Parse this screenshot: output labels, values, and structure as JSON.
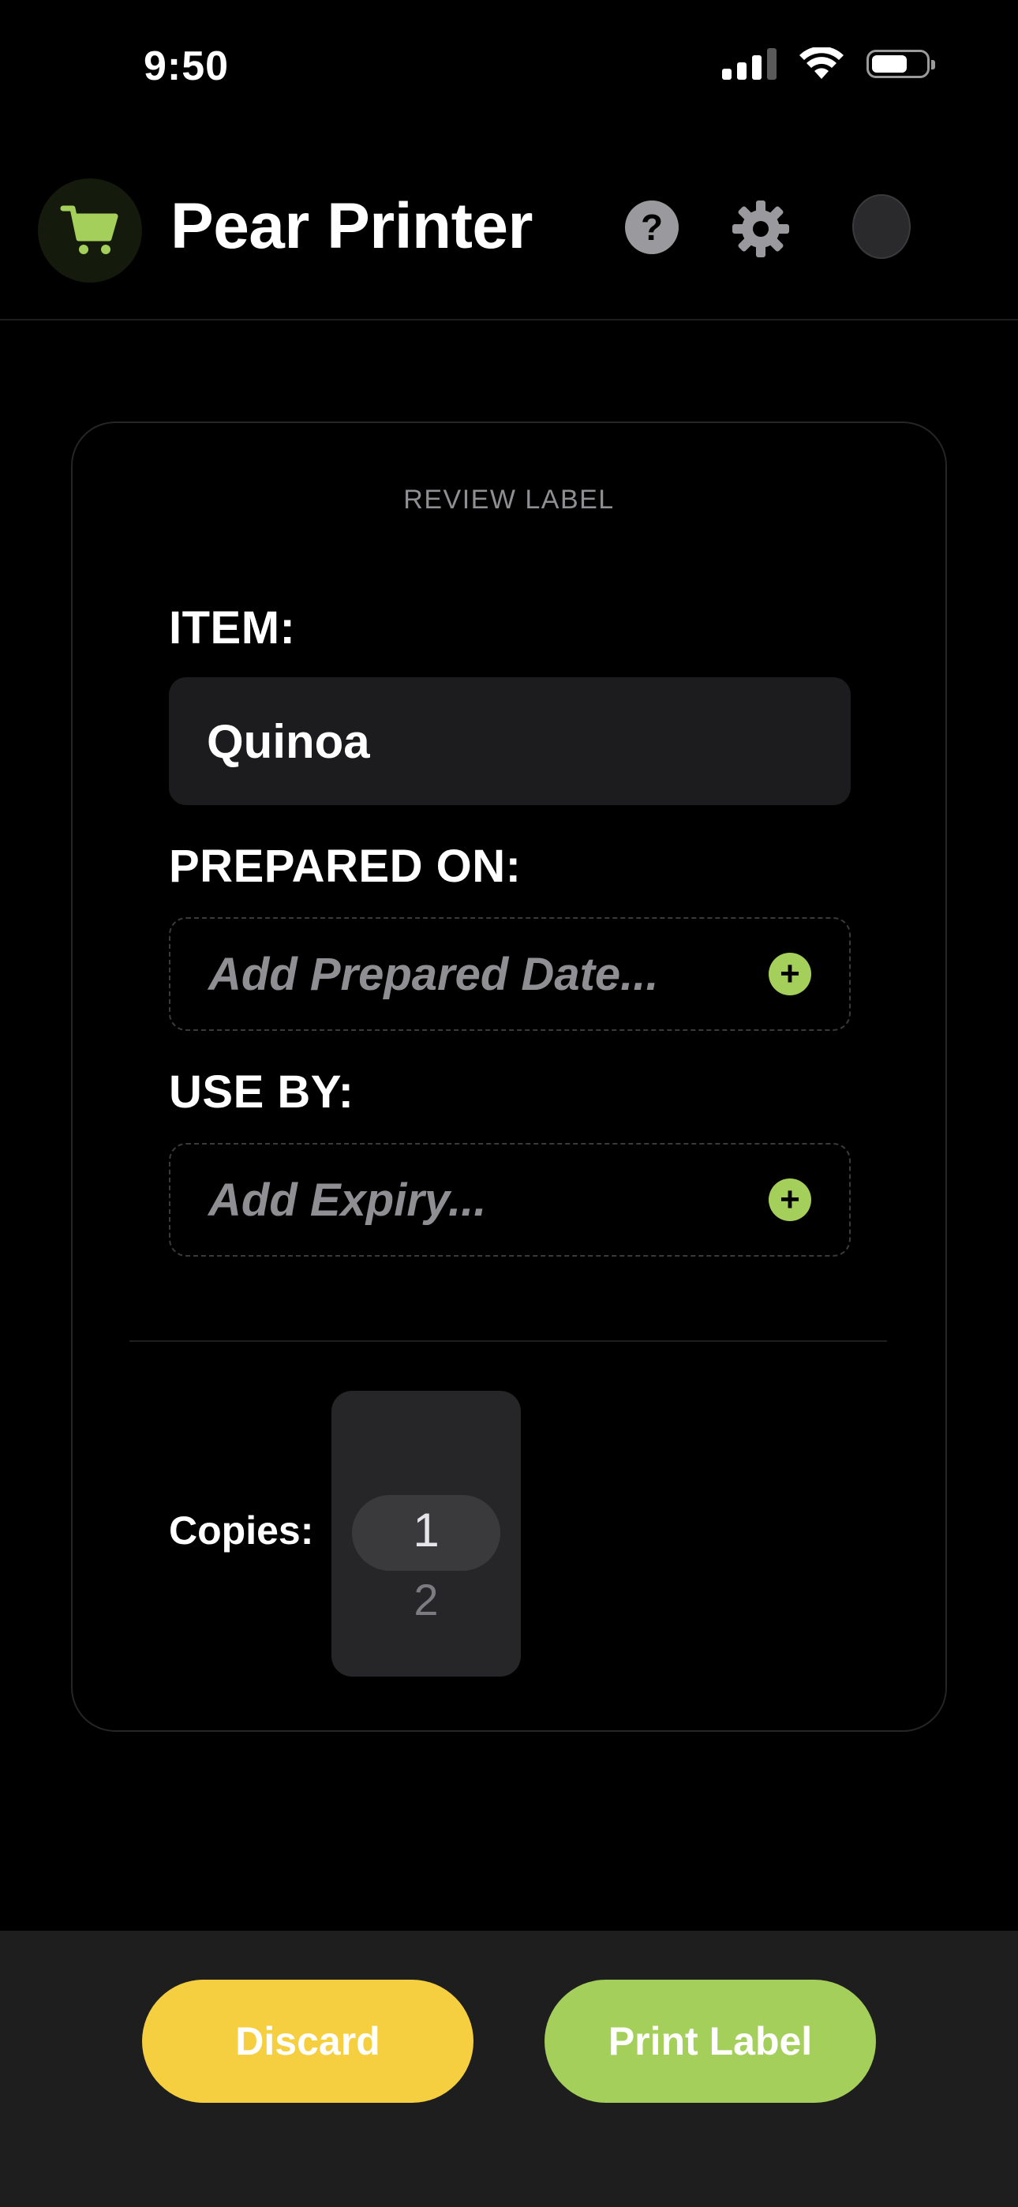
{
  "status_bar": {
    "time": "9:50"
  },
  "header": {
    "title": "Pear Printer",
    "help_glyph": "?",
    "icons": [
      "cart-icon",
      "help-icon",
      "gear-icon",
      "avatar"
    ],
    "accent_color": "#a5cf5b"
  },
  "card": {
    "title": "REVIEW LABEL",
    "item": {
      "label": "ITEM:",
      "value": "Quinoa"
    },
    "prepared": {
      "label": "PREPARED ON:",
      "placeholder": "Add Prepared Date...",
      "add_glyph": "+"
    },
    "use_by": {
      "label": "USE BY:",
      "placeholder": "Add Expiry...",
      "add_glyph": "+"
    },
    "copies": {
      "label": "Copies:",
      "selected": "1",
      "next": "2"
    }
  },
  "actions": {
    "discard_label": "Discard",
    "discard_color": "#f5cf3f",
    "print_label": "Print Label",
    "print_color": "#a5cf5b"
  }
}
